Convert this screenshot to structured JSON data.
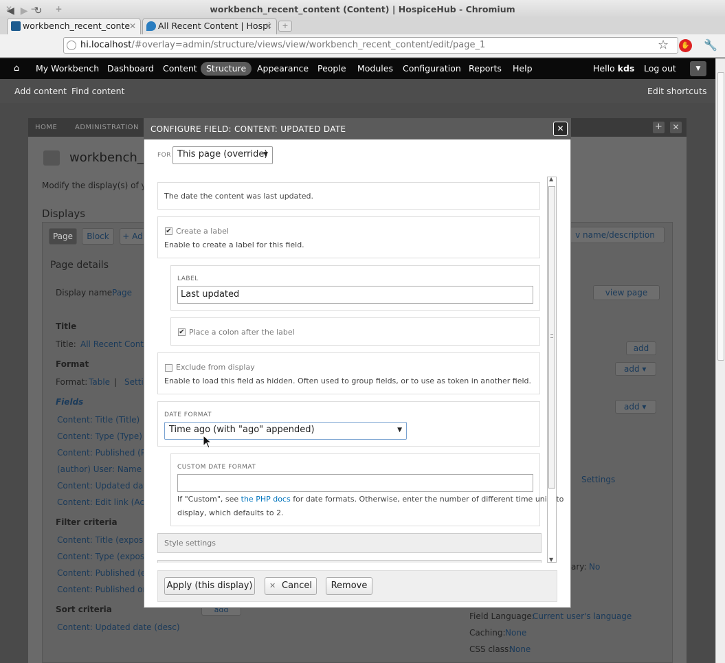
{
  "window": {
    "title": "workbench_recent_content (Content) | HospiceHub - Chromium"
  },
  "tabs": [
    {
      "label": "workbench_recent_conte",
      "active": true
    },
    {
      "label": "All Recent Content | Hospi",
      "active": false
    }
  ],
  "address": {
    "domain": "hi.localhost",
    "path": "/#overlay=admin/structure/views/view/workbench_recent_content/edit/page_1"
  },
  "toolbar": {
    "items": [
      "My Workbench",
      "Dashboard",
      "Content",
      "Structure",
      "Appearance",
      "People",
      "Modules",
      "Configuration",
      "Reports",
      "Help"
    ],
    "active": "Structure",
    "hello_prefix": "Hello ",
    "user": "kds",
    "logout": "Log out"
  },
  "shortcuts": {
    "items": [
      "Add content",
      "Find content"
    ],
    "edit": "Edit shortcuts"
  },
  "background": {
    "breadcrumb": [
      "HOME",
      "ADMINISTRATION"
    ],
    "page_title": "workbench_re",
    "intro": "Modify the display(s) of y",
    "displays_heading": "Displays",
    "display_tabs": [
      "Page",
      "Block",
      "+ Ad"
    ],
    "name_desc": "v name/description",
    "page_details": "Page details",
    "display_name_label": "Display name:",
    "display_name_value": "Page",
    "view_page": "view page",
    "title_heading": "Title",
    "title_label": "Title:",
    "title_value": "All Recent Conte",
    "format_heading": "Format",
    "format_label": "Format:",
    "format_value": "Table",
    "format_sep": "|",
    "format_settings": "Setti",
    "fields_heading": "Fields",
    "fields": [
      "Content: Title (Title)",
      "Content: Type (Type)",
      "Content: Published (Pu",
      "(author) User: Name (A",
      "Content: Updated date",
      "Content: Edit link (Acti"
    ],
    "filter_heading": "Filter criteria",
    "filters": [
      "Content: Title (expose",
      "Content: Type (expose",
      "Content: Published (ex",
      "Content: Published or"
    ],
    "sort_heading": "Sort criteria",
    "sort_add": "add",
    "sorts": [
      "Content: Updated date (desc)"
    ],
    "add_label": "add",
    "settings_link": "Settings",
    "ary_label": "ary:",
    "ary_value": "No",
    "field_language_label": "Field Language:",
    "field_language_value": "Current user's language",
    "caching_label": "Caching:",
    "caching_value": "None",
    "css_label": "CSS class:",
    "css_value": "None"
  },
  "modal": {
    "title": "CONFIGURE FIELD: CONTENT: UPDATED DATE",
    "for_label": "FOR",
    "for_value": "This page (override)",
    "description": "The date the content was last updated.",
    "create_label": "Create a label",
    "create_label_desc": "Enable to create a label for this field.",
    "create_label_checked": true,
    "label_heading": "LABEL",
    "label_value": "Last updated",
    "colon_label": "Place a colon after the label",
    "colon_checked": true,
    "exclude_label": "Exclude from display",
    "exclude_checked": false,
    "exclude_desc": "Enable to load this field as hidden. Often used to group fields, or to use as token in another field.",
    "date_format_heading": "DATE FORMAT",
    "date_format_value": "Time ago (with \"ago\" appended)",
    "custom_heading": "CUSTOM DATE FORMAT",
    "custom_value": "",
    "custom_desc_pre": "If \"Custom\", see ",
    "custom_desc_link": "the PHP docs",
    "custom_desc_post": " for date formats. Otherwise, enter the number of different time units to",
    "custom_desc_line2": "display, which defaults to 2.",
    "style_settings": "Style settings",
    "apply": "Apply (this display)",
    "cancel": "Cancel",
    "remove": "Remove"
  }
}
